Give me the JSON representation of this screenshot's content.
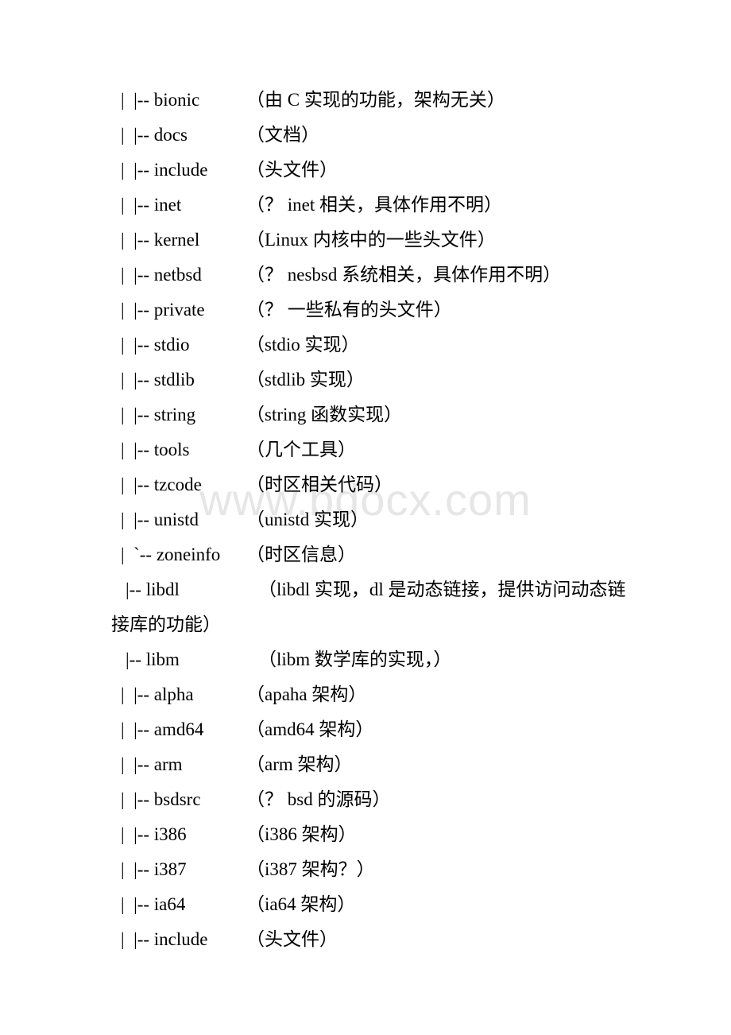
{
  "watermark": {
    "text": "www.bdocx.com",
    "color": "#e6e6e6"
  },
  "document": {
    "type": "directory-tree-listing",
    "lines": [
      {
        "depth": 2,
        "prefix": "|  |--",
        "name": "bionic",
        "comment": "（由 C 实现的功能，架构无关）"
      },
      {
        "depth": 2,
        "prefix": "|  |--",
        "name": "docs",
        "comment": "（文档）"
      },
      {
        "depth": 2,
        "prefix": "|  |--",
        "name": "include",
        "comment": "（头文件）"
      },
      {
        "depth": 2,
        "prefix": "|  |--",
        "name": "inet",
        "comment": "（？ inet 相关，具体作用不明）"
      },
      {
        "depth": 2,
        "prefix": "|  |--",
        "name": "kernel",
        "comment": "（Linux 内核中的一些头文件）"
      },
      {
        "depth": 2,
        "prefix": "|  |--",
        "name": "netbsd",
        "comment": "（？ nesbsd 系统相关，具体作用不明）"
      },
      {
        "depth": 2,
        "prefix": "|  |--",
        "name": "private",
        "comment": "（？ 一些私有的头文件）"
      },
      {
        "depth": 2,
        "prefix": "|  |--",
        "name": "stdio",
        "comment": "（stdio 实现）"
      },
      {
        "depth": 2,
        "prefix": "|  |--",
        "name": "stdlib",
        "comment": "（stdlib 实现）"
      },
      {
        "depth": 2,
        "prefix": "|  |--",
        "name": "string",
        "comment": "（string 函数实现）"
      },
      {
        "depth": 2,
        "prefix": "|  |--",
        "name": "tools",
        "comment": "（几个工具）"
      },
      {
        "depth": 2,
        "prefix": "|  |--",
        "name": "tzcode",
        "comment": "（时区相关代码）"
      },
      {
        "depth": 2,
        "prefix": "|  |--",
        "name": "unistd",
        "comment": "（unistd 实现）"
      },
      {
        "depth": 2,
        "prefix": "|  `--",
        "name": "zoneinfo",
        "comment": "（时区信息）"
      },
      {
        "depth": 1,
        "prefix": "|--",
        "name": "libdl",
        "comment": "（libdl 实现，dl 是动态链接，提供访问动态链",
        "continuation": "接库的功能）"
      },
      {
        "depth": 1,
        "prefix": "|--",
        "name": "libm",
        "comment": "（libm 数学库的实现，）"
      },
      {
        "depth": 2,
        "prefix": "|  |--",
        "name": "alpha",
        "comment": "（apaha 架构）"
      },
      {
        "depth": 2,
        "prefix": "|  |--",
        "name": "amd64",
        "comment": "（amd64 架构）"
      },
      {
        "depth": 2,
        "prefix": "|  |--",
        "name": "arm",
        "comment": "（arm 架构）"
      },
      {
        "depth": 2,
        "prefix": "|  |--",
        "name": "bsdsrc",
        "comment": "（？ bsd 的源码）"
      },
      {
        "depth": 2,
        "prefix": "|  |--",
        "name": "i386",
        "comment": "（i386 架构）"
      },
      {
        "depth": 2,
        "prefix": "|  |--",
        "name": "i387",
        "comment": "（i387 架构？）"
      },
      {
        "depth": 2,
        "prefix": "|  |--",
        "name": "ia64",
        "comment": "（ia64 架构）"
      },
      {
        "depth": 2,
        "prefix": "|  |--",
        "name": "include",
        "comment": "（头文件）"
      }
    ]
  }
}
